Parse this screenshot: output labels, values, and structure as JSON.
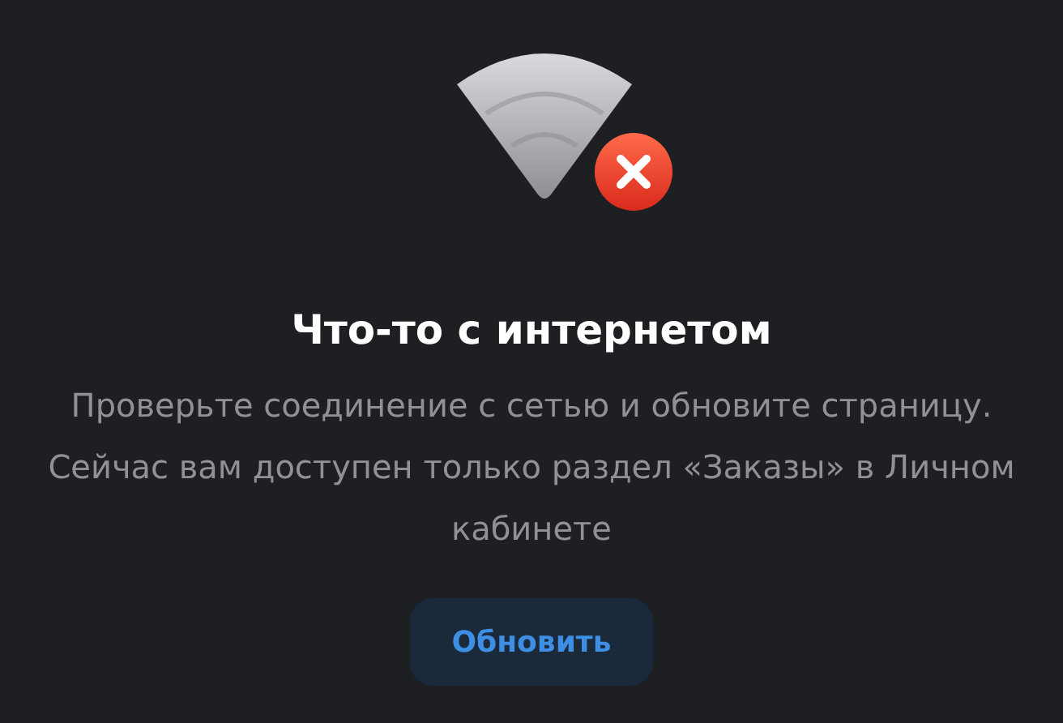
{
  "title": "Что-то с интернетом",
  "message": "Проверьте соединение с сетью и обновите страницу. Сейчас вам доступен только раздел «Заказы» в Личном кабинете",
  "button": {
    "label": "Обновить"
  }
}
